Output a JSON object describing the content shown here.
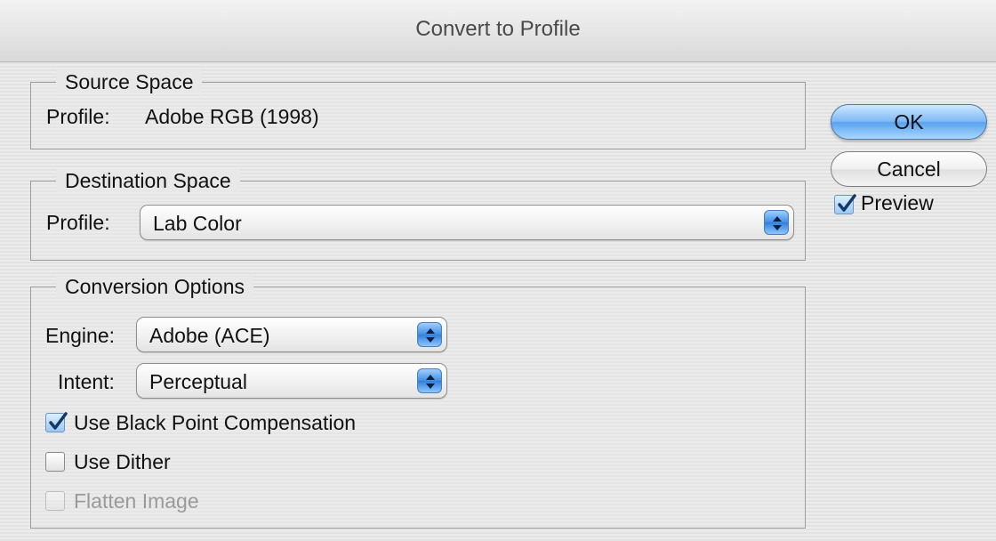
{
  "window": {
    "title": "Convert to Profile"
  },
  "source_space": {
    "legend": "Source Space",
    "profile_label": "Profile:",
    "profile_value": "Adobe RGB (1998)"
  },
  "destination_space": {
    "legend": "Destination Space",
    "profile_label": "Profile:",
    "profile_value": "Lab Color"
  },
  "conversion_options": {
    "legend": "Conversion Options",
    "engine_label": "Engine:",
    "engine_value": "Adobe (ACE)",
    "intent_label": "Intent:",
    "intent_value": "Perceptual",
    "black_point": {
      "label": "Use Black Point Compensation",
      "checked": true
    },
    "dither": {
      "label": "Use Dither",
      "checked": false
    },
    "flatten": {
      "label": "Flatten Image",
      "checked": false,
      "enabled": false
    }
  },
  "buttons": {
    "ok": "OK",
    "cancel": "Cancel"
  },
  "preview": {
    "label": "Preview",
    "checked": true
  },
  "colors": {
    "accent": "#5aa3ee",
    "check": "#123a66"
  },
  "icons": {
    "checkmark": "checkmark-icon",
    "stepper": "popup-arrows-icon"
  }
}
